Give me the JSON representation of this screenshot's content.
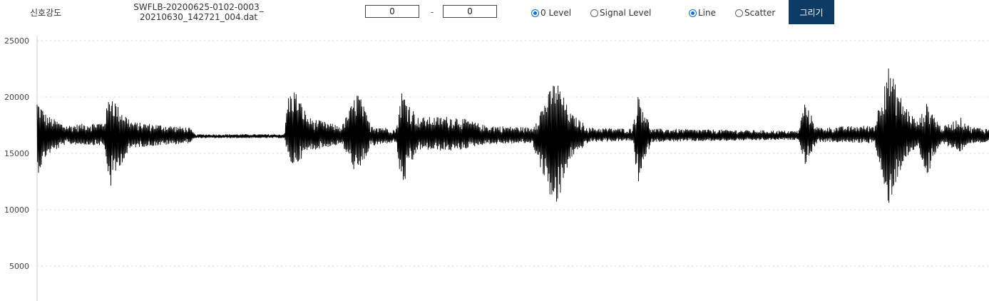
{
  "toolbar": {
    "label": "신호강도",
    "filename": "SWFLB-20200625-0102-0003_20210630_142721_004.dat",
    "range_start": "0",
    "range_dash": "-",
    "range_end": "0",
    "mode_options": [
      {
        "label": "0 Level",
        "checked": true
      },
      {
        "label": "Signal Level",
        "checked": false
      }
    ],
    "type_options": [
      {
        "label": "Line",
        "checked": true
      },
      {
        "label": "Scatter",
        "checked": false
      }
    ],
    "draw_label": "그리기"
  },
  "colors": {
    "button_bg": "#0d3b66",
    "radio_accent": "#0a6fd8",
    "series_line": "#000000",
    "grid": "#d8d8d8"
  },
  "chart_data": {
    "type": "line",
    "grid": "horizontal-dotted",
    "ylim": [
      3000,
      25000
    ],
    "yticks": [
      25000,
      20000,
      15000,
      10000,
      5000
    ],
    "baseline": 16500,
    "series": [
      {
        "samples": 2000,
        "envelope": [
          {
            "t": 0.0,
            "upper": 19800,
            "lower": 13000
          },
          {
            "t": 0.01,
            "upper": 18400,
            "lower": 14800
          },
          {
            "t": 0.03,
            "upper": 17500,
            "lower": 15800
          },
          {
            "t": 0.07,
            "upper": 17800,
            "lower": 15700
          },
          {
            "t": 0.077,
            "upper": 20600,
            "lower": 11800
          },
          {
            "t": 0.085,
            "upper": 19200,
            "lower": 13600
          },
          {
            "t": 0.1,
            "upper": 17800,
            "lower": 15500
          },
          {
            "t": 0.16,
            "upper": 17300,
            "lower": 15900
          },
          {
            "t": 0.166,
            "upper": 16700,
            "lower": 16350
          },
          {
            "t": 0.26,
            "upper": 16700,
            "lower": 16350
          },
          {
            "t": 0.263,
            "upper": 20000,
            "lower": 14500
          },
          {
            "t": 0.27,
            "upper": 20800,
            "lower": 13800
          },
          {
            "t": 0.285,
            "upper": 18200,
            "lower": 15200
          },
          {
            "t": 0.32,
            "upper": 17400,
            "lower": 15800
          },
          {
            "t": 0.337,
            "upper": 20600,
            "lower": 12800
          },
          {
            "t": 0.35,
            "upper": 17600,
            "lower": 15600
          },
          {
            "t": 0.377,
            "upper": 17100,
            "lower": 16000
          },
          {
            "t": 0.383,
            "upper": 20600,
            "lower": 11800
          },
          {
            "t": 0.4,
            "upper": 18200,
            "lower": 15300
          },
          {
            "t": 0.44,
            "upper": 18300,
            "lower": 15200
          },
          {
            "t": 0.47,
            "upper": 17500,
            "lower": 15800
          },
          {
            "t": 0.52,
            "upper": 17300,
            "lower": 15900
          },
          {
            "t": 0.545,
            "upper": 21700,
            "lower": 9700
          },
          {
            "t": 0.56,
            "upper": 18600,
            "lower": 14500
          },
          {
            "t": 0.58,
            "upper": 17300,
            "lower": 16000
          },
          {
            "t": 0.625,
            "upper": 17200,
            "lower": 16100
          },
          {
            "t": 0.632,
            "upper": 20400,
            "lower": 12200
          },
          {
            "t": 0.645,
            "upper": 17200,
            "lower": 16000
          },
          {
            "t": 0.8,
            "upper": 17000,
            "lower": 16200
          },
          {
            "t": 0.806,
            "upper": 19600,
            "lower": 13900
          },
          {
            "t": 0.82,
            "upper": 17300,
            "lower": 16000
          },
          {
            "t": 0.88,
            "upper": 17500,
            "lower": 15900
          },
          {
            "t": 0.893,
            "upper": 23000,
            "lower": 10000
          },
          {
            "t": 0.91,
            "upper": 19500,
            "lower": 14200
          },
          {
            "t": 0.925,
            "upper": 17800,
            "lower": 15600
          },
          {
            "t": 0.935,
            "upper": 19500,
            "lower": 12900
          },
          {
            "t": 0.95,
            "upper": 17300,
            "lower": 15900
          },
          {
            "t": 0.97,
            "upper": 18200,
            "lower": 15100
          },
          {
            "t": 0.98,
            "upper": 17400,
            "lower": 15900
          },
          {
            "t": 1.0,
            "upper": 17200,
            "lower": 15900
          }
        ]
      }
    ]
  }
}
